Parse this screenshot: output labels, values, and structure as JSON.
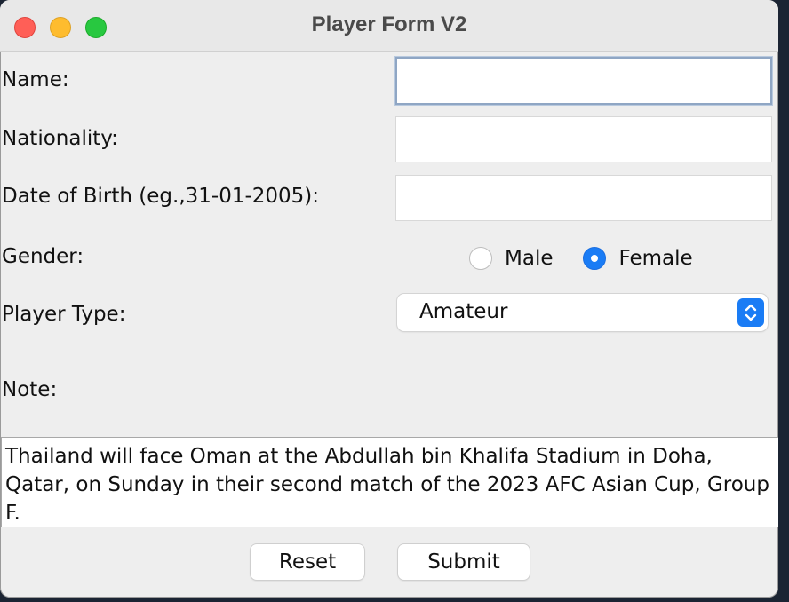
{
  "window": {
    "title": "Player Form V2"
  },
  "form": {
    "name_label": "Name:",
    "name_value": "",
    "nationality_label": "Nationality:",
    "nationality_value": "",
    "dob_label": "Date of Birth (eg.,31-01-2005):",
    "dob_value": "",
    "gender_label": "Gender:",
    "gender_options": [
      {
        "label": "Male",
        "selected": false
      },
      {
        "label": "Female",
        "selected": true
      }
    ],
    "player_type_label": "Player Type:",
    "player_type_selected": "Amateur",
    "note_label": "Note:",
    "note_value": "Thailand will face Oman at the Abdullah bin Khalifa Stadium in Doha, Qatar, on Sunday in their second match of the 2023 AFC Asian Cup, Group F."
  },
  "buttons": {
    "reset_label": "Reset",
    "submit_label": "Submit"
  },
  "colors": {
    "accent": "#1a7cf5",
    "window_bg": "#eeeeee",
    "desktop_bg": "#1b2433"
  }
}
